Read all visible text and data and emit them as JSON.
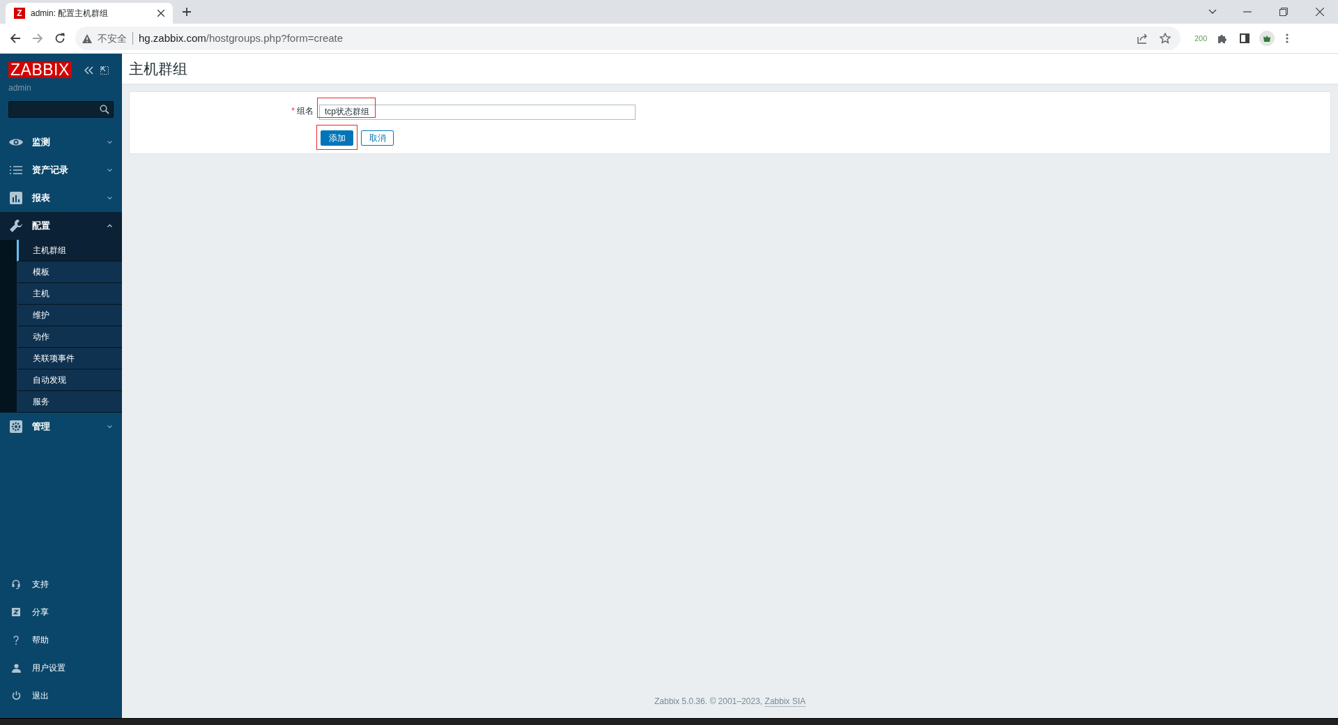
{
  "browser": {
    "tabs": [
      {
        "favicon": "Z",
        "title": "admin: 配置主机群组",
        "selected": true
      }
    ],
    "security_label": "不安全",
    "url_host": "hg.zabbix.com",
    "url_path": "/hostgroups.php?form=create",
    "extension_badge": "200"
  },
  "sidebar": {
    "logo": "ZABBIX",
    "user": "admin",
    "menu": [
      {
        "label": "监测",
        "kind": "eye",
        "expanded": false
      },
      {
        "label": "资产记录",
        "kind": "list",
        "expanded": false
      },
      {
        "label": "报表",
        "kind": "chart",
        "expanded": false
      },
      {
        "label": "配置",
        "kind": "wrench",
        "expanded": true,
        "children": [
          {
            "label": "主机群组",
            "selected": true
          },
          {
            "label": "模板",
            "selected": false
          },
          {
            "label": "主机",
            "selected": false
          },
          {
            "label": "维护",
            "selected": false
          },
          {
            "label": "动作",
            "selected": false
          },
          {
            "label": "关联项事件",
            "selected": false
          },
          {
            "label": "自动发现",
            "selected": false
          },
          {
            "label": "服务",
            "selected": false
          }
        ]
      },
      {
        "label": "管理",
        "kind": "gear",
        "expanded": false
      }
    ],
    "bottom": [
      {
        "label": "支持",
        "kind": "headset"
      },
      {
        "label": "分享",
        "kind": "zbox"
      },
      {
        "label": "帮助",
        "kind": "question"
      },
      {
        "label": "用户设置",
        "kind": "user"
      },
      {
        "label": "退出",
        "kind": "power"
      }
    ]
  },
  "page": {
    "title": "主机群组",
    "form": {
      "fields": [
        {
          "label": "组名",
          "required_mark": "*",
          "value": "tcp状态群组",
          "highlighted": true
        }
      ],
      "buttons": [
        {
          "label": "添加",
          "kind": "primary",
          "highlighted": true
        },
        {
          "label": "取消",
          "kind": "secondary"
        }
      ]
    }
  },
  "footer": {
    "text": "Zabbix 5.0.36. © 2001–2023, ",
    "link": "Zabbix SIA"
  }
}
